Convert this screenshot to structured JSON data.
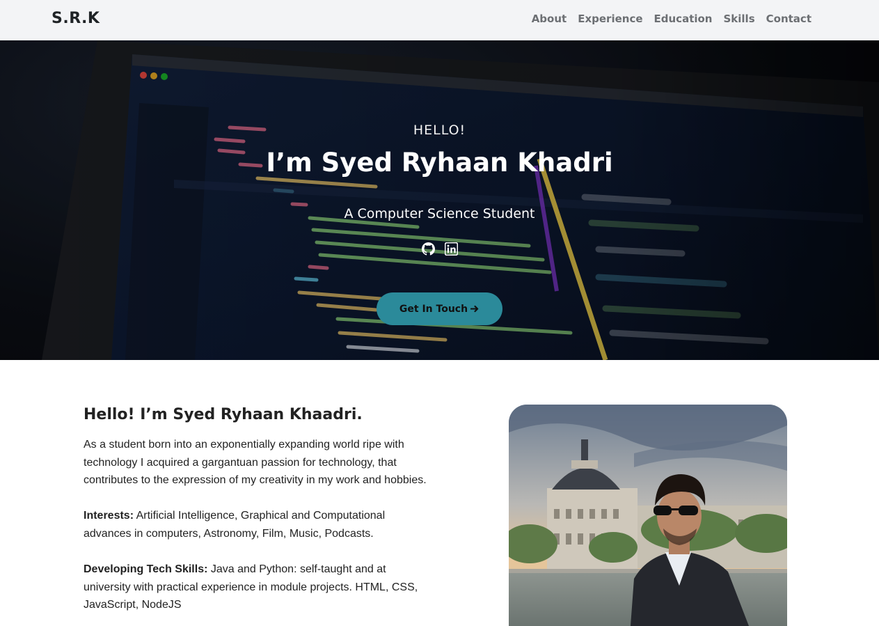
{
  "navbar": {
    "brand": "S.R.K",
    "links": [
      {
        "label": "About"
      },
      {
        "label": "Experience"
      },
      {
        "label": "Education"
      },
      {
        "label": "Skills"
      },
      {
        "label": "Contact"
      }
    ]
  },
  "hero": {
    "greeting": "HELLO!",
    "name": "I’m Syed Ryhaan Khadri",
    "role": "A Computer Science Student",
    "icons": [
      "github-icon",
      "linkedin-icon"
    ],
    "cta_label": "Get In Touch",
    "cta_icon": "arrow-right-icon",
    "accent_color": "#2b8a9a"
  },
  "about": {
    "title": "Hello! I’m Syed Ryhaan Khaadri.",
    "intro": "As a student born into an exponentially expanding world ripe with technology I acquired a gargantuan passion for technology, that contributes to the expression of my creativity in my work and hobbies.",
    "interests_label": "Interests:",
    "interests_text": " Artificial Intelligence, Graphical and Computational advances in computers, Astronomy, Film, Music, Podcasts.",
    "skills_label": "Developing Tech Skills:",
    "skills_text": " Java and Python: self-taught and at university with practical experience in module projects. HTML, CSS, JavaScript, NodeJS"
  }
}
